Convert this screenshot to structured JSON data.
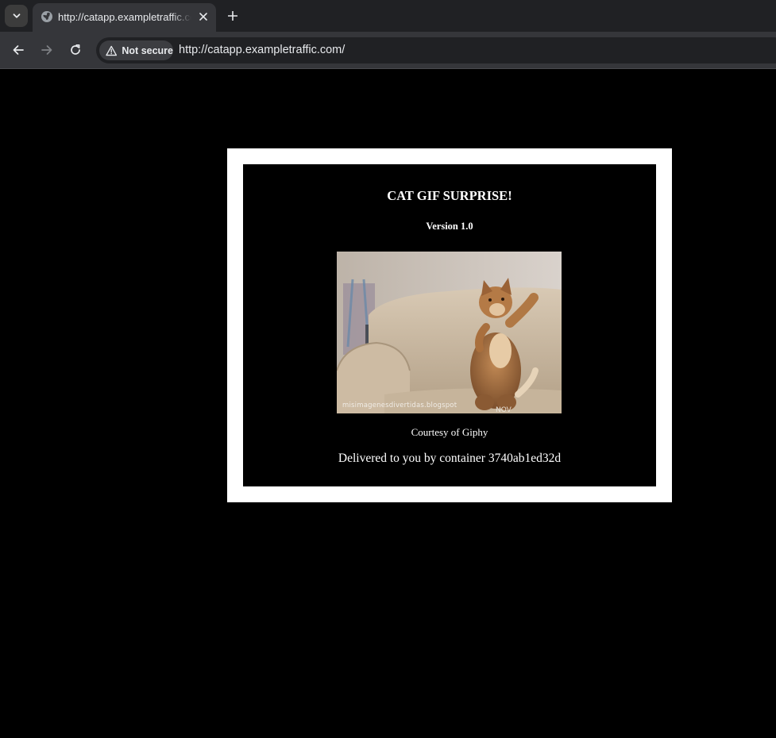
{
  "browser": {
    "tab": {
      "title": "http://catapp.exampletraffic.com/"
    },
    "toolbar": {
      "security_label": "Not secure",
      "url": "http://catapp.exampletraffic.com/"
    },
    "icons": {
      "tab_search": "chevron-down-icon",
      "favicon": "globe-icon",
      "close": "close-icon",
      "new_tab": "plus-icon",
      "back": "arrow-left-icon",
      "forward": "arrow-right-icon",
      "reload": "reload-icon",
      "warning": "warning-triangle-icon"
    }
  },
  "page": {
    "title": "CAT GIF SURPRISE!",
    "version": "Version 1.0",
    "gif_watermark": "misimagenesdivertidas.blogspot",
    "courtesy": "Courtesy of Giphy",
    "delivered": "Delivered to you by container 3740ab1ed32d"
  },
  "colors": {
    "page_background": "#000000",
    "frame_border": "#ffffff",
    "text": "#ffffff",
    "chrome_dark": "#202124",
    "chrome_tab": "#35363a"
  }
}
